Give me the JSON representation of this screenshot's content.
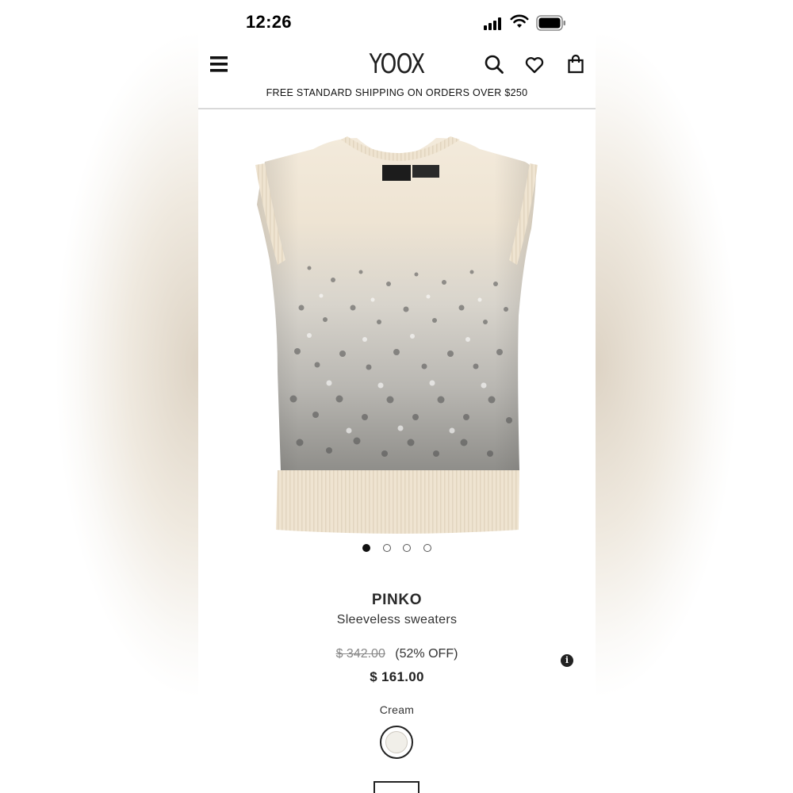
{
  "status_bar": {
    "time": "12:26"
  },
  "header": {
    "logo": "YOOX",
    "menu_icon": "hamburger-menu-icon",
    "search_icon": "search-icon",
    "wishlist_icon": "heart-icon",
    "bag_icon": "shopping-bag-icon"
  },
  "promo_banner": "FREE STANDARD SHIPPING ON ORDERS OVER $250",
  "gallery": {
    "image_description_icon": "sequin-sleeveless-sweater-image",
    "image_count": 4,
    "active_index": 0
  },
  "product": {
    "brand": "PINKO",
    "category": "Sleeveless sweaters",
    "original_price": "$ 342.00",
    "discount": "(52% OFF)",
    "sale_price": "$ 161.00",
    "color_label": "Cream",
    "color_swatch": "#f1efe9"
  },
  "colors": {
    "accent": "#111111",
    "garment_base": "#f3eadb",
    "sequin_dark": "#5a5a5a"
  }
}
